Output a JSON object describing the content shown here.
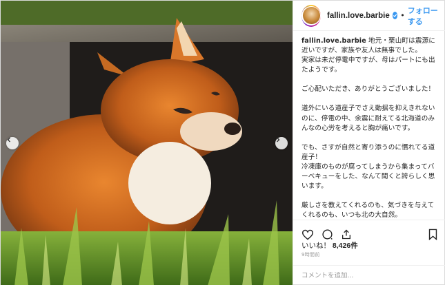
{
  "post": {
    "username": "fallin.love.barbie",
    "follow_label": "フォローする",
    "separator": "•",
    "caption_paragraphs": [
      "地元・栗山町は震源に近いですが、家族や友人は無事でした。\n実家は未だ停電中ですが、母はパートにも出たようです。",
      "ご心配いただき、ありがとうございました！",
      "道外にいる道産子でさえ動揺を抑えきれないのに、停電の中、余震に耐えてる北海道のみんなの心労を考えると胸が痛いです。",
      "でも、さすが自然と寄り添うのに慣れてる道産子！\n冷凍庫のものが腐ってしまうから集まってバーベキューをした、なんて聞くと誇らしく思います。",
      "厳しさを教えてくれるのも、気づきを与えてくれるのも、いつも北の大自然。"
    ],
    "likes_prefix": "いいね！",
    "likes_count": "8,426件",
    "time_ago": "9時間前",
    "comment_placeholder": "コメントを追加..."
  },
  "icons": {
    "verified": "verified-badge-icon",
    "like": "heart-icon",
    "comment": "comment-icon",
    "share": "share-icon",
    "save": "bookmark-icon",
    "prev": "chevron-left-icon",
    "next": "chevron-right-icon"
  },
  "colors": {
    "link": "#3897f0",
    "text": "#262626",
    "muted": "#999999"
  }
}
